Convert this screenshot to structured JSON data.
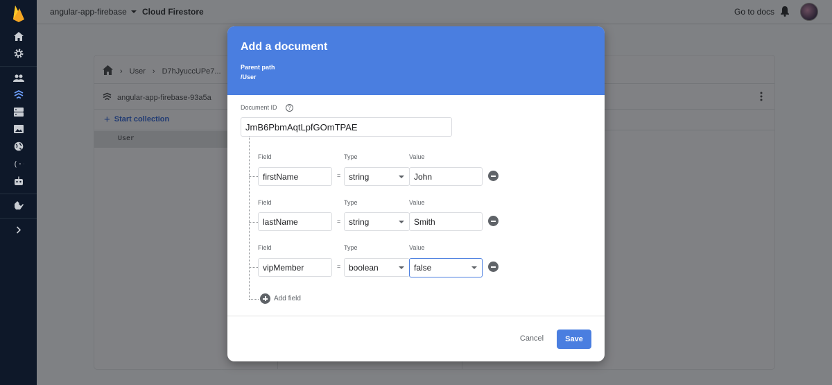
{
  "topbar": {
    "project": "angular-app-firebase",
    "product": "Cloud Firestore",
    "docs_link": "Go to docs"
  },
  "rail": {
    "icons": [
      "firebase-logo",
      "home-icon",
      "gear-icon",
      "users-icon",
      "firestore-icon",
      "database-icon",
      "image-icon",
      "globe-icon",
      "functions-icon",
      "robot-icon",
      "extensions-icon",
      "chevron-right-icon"
    ]
  },
  "panel": {
    "breadcrumb": [
      "User",
      "D7hJyuccUPe7..."
    ],
    "database": "angular-app-firebase-93a5a",
    "start_collection": "Start collection",
    "collection": "User"
  },
  "dialog": {
    "title": "Add a document",
    "parent_path_label": "Parent path",
    "parent_path": "/User",
    "document_id_label": "Document ID",
    "document_id": "JmB6PbmAqtLpfGOmTPAE",
    "field_label": "Field",
    "type_label": "Type",
    "value_label": "Value",
    "equals": "=",
    "fields": [
      {
        "name": "firstName",
        "type": "string",
        "value": "John"
      },
      {
        "name": "lastName",
        "type": "string",
        "value": "Smith"
      },
      {
        "name": "vipMember",
        "type": "boolean",
        "value": "false"
      }
    ],
    "add_field": "Add field",
    "cancel": "Cancel",
    "save": "Save"
  },
  "colors": {
    "accent": "#4a7ee0",
    "rail": "#0e1829"
  }
}
